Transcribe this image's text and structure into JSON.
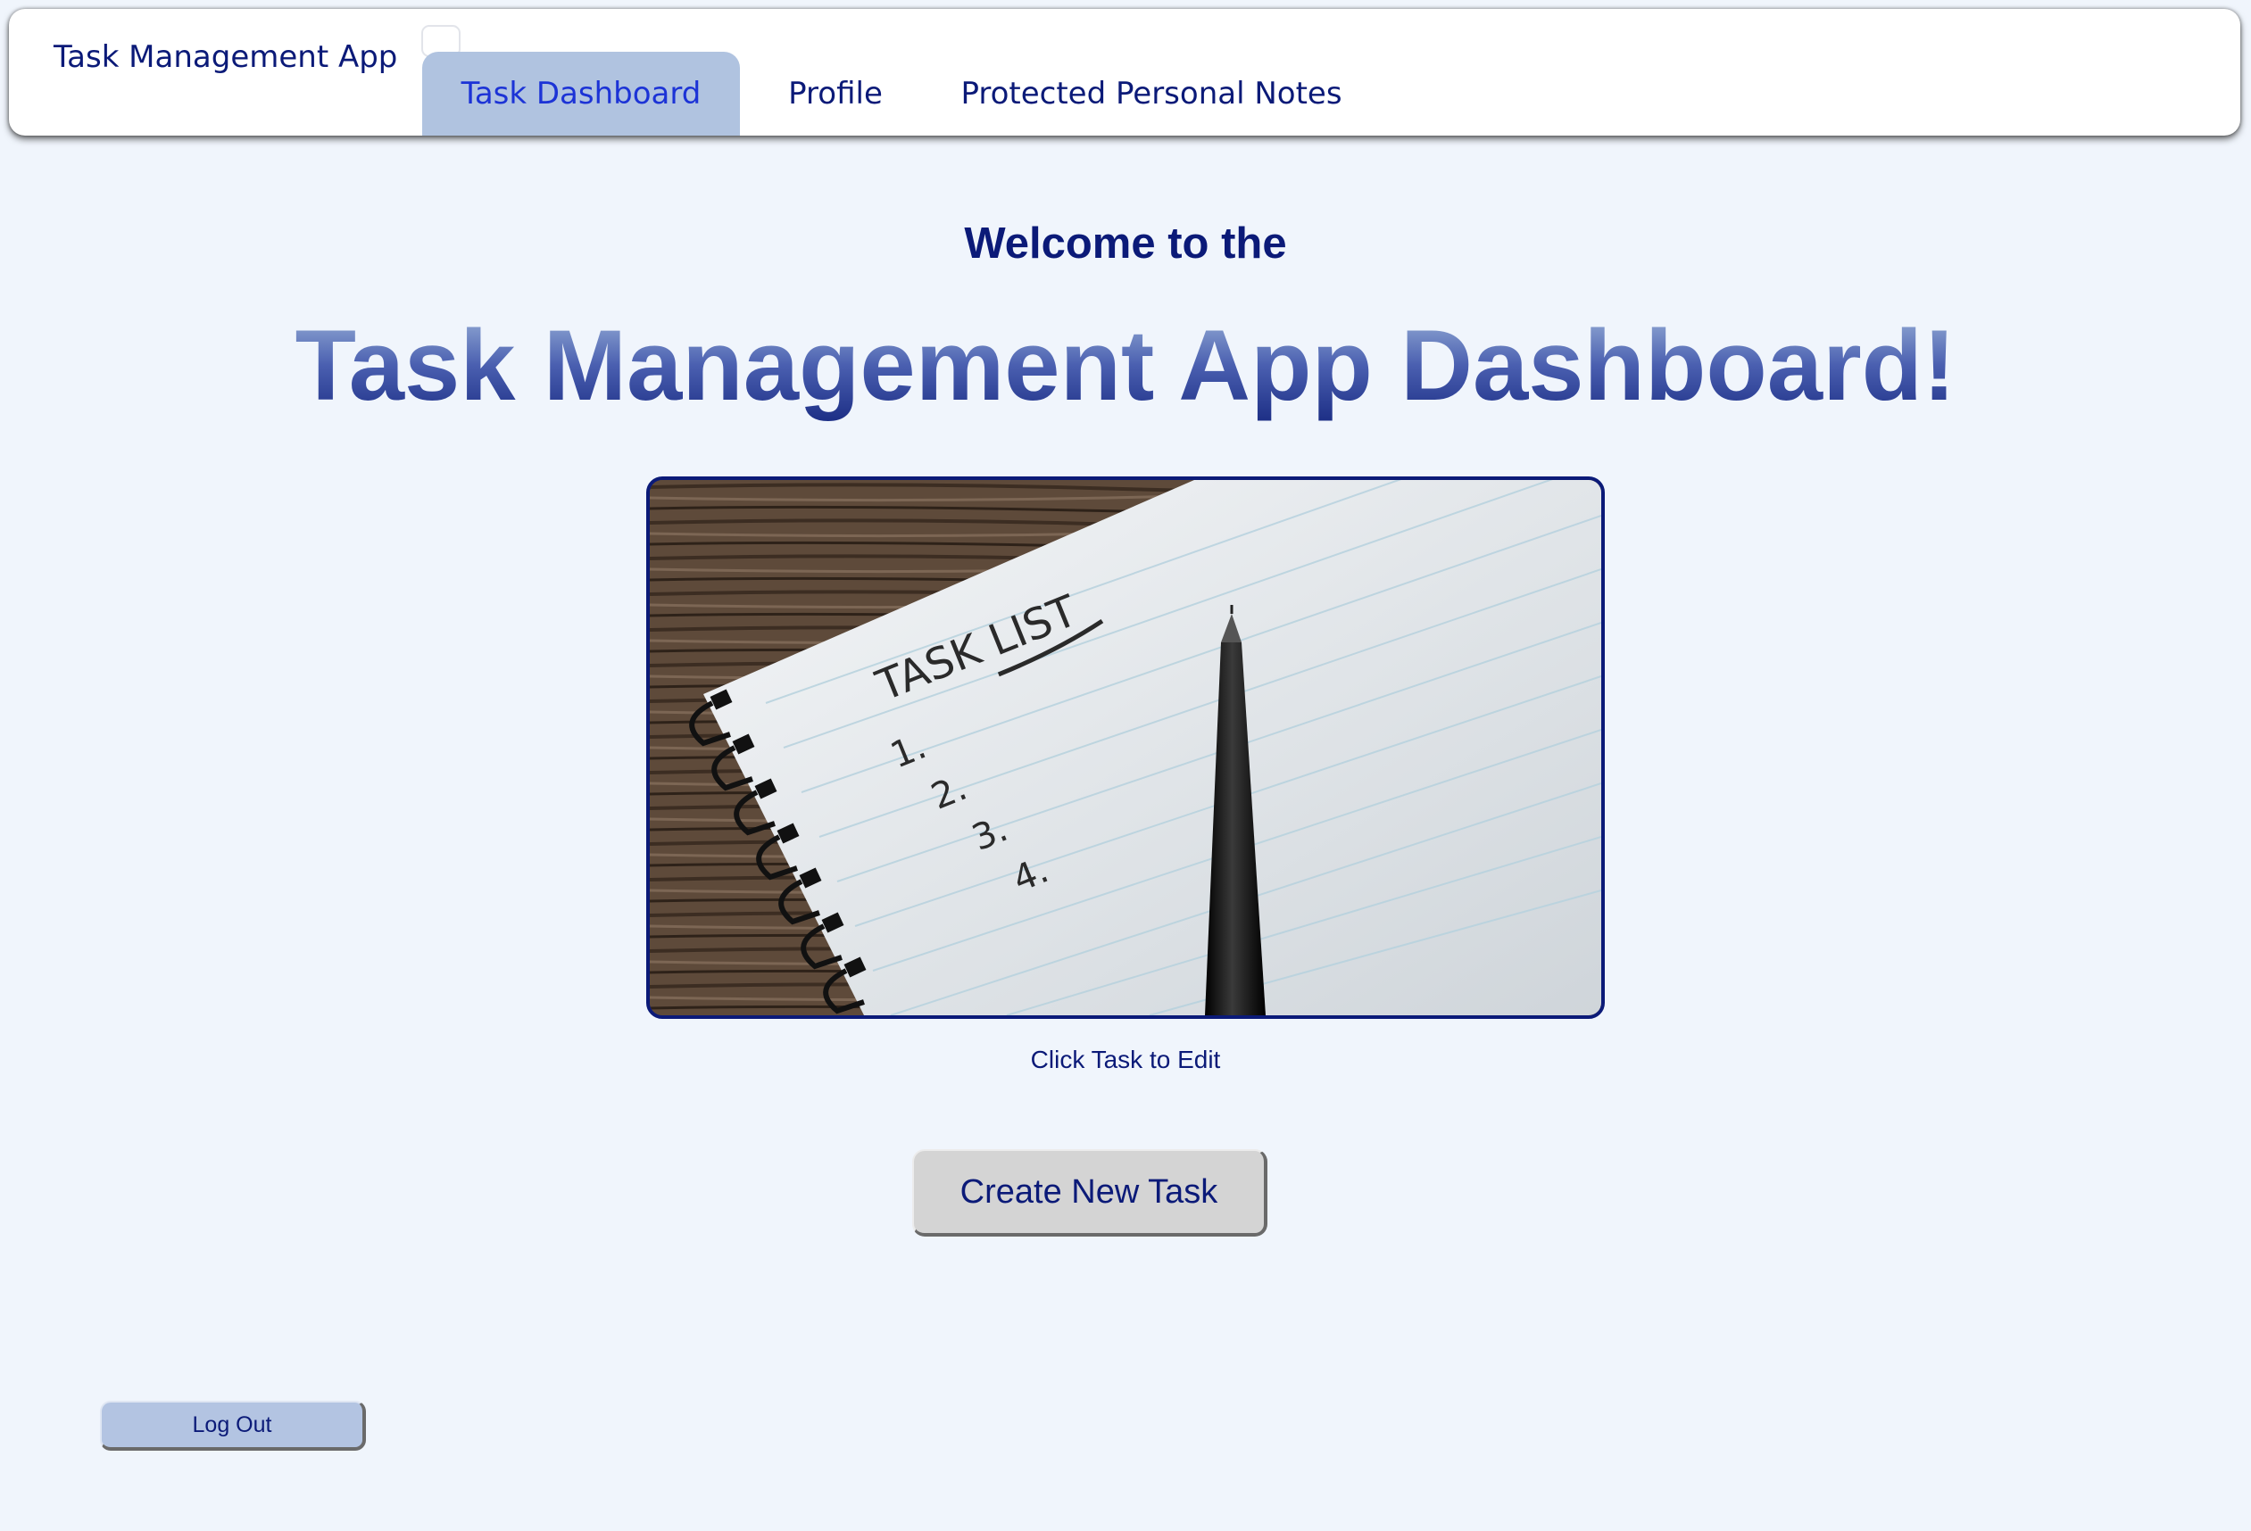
{
  "navbar": {
    "brand": "Task Management App",
    "tabs": [
      {
        "label": "Task Dashboard",
        "active": true
      },
      {
        "label": "Profile",
        "active": false
      },
      {
        "label": "Protected Personal Notes",
        "active": false
      }
    ]
  },
  "main": {
    "welcome": "Welcome to the",
    "title": "Task Management App Dashboard!",
    "image": {
      "heading": "TASK LIST",
      "list_numbers": [
        "1.",
        "2.",
        "3.",
        "4."
      ]
    },
    "hint": "Click Task to Edit",
    "create_button": "Create New Task"
  },
  "footer": {
    "logout_button": "Log Out"
  },
  "colors": {
    "page_background": "#f0f5fc",
    "navy_text": "#0b1a78",
    "active_tab_background": "#b0c3e0",
    "active_tab_text": "#1c33d6",
    "logout_background": "#b3c4e2",
    "create_background": "#d4d4d4"
  }
}
